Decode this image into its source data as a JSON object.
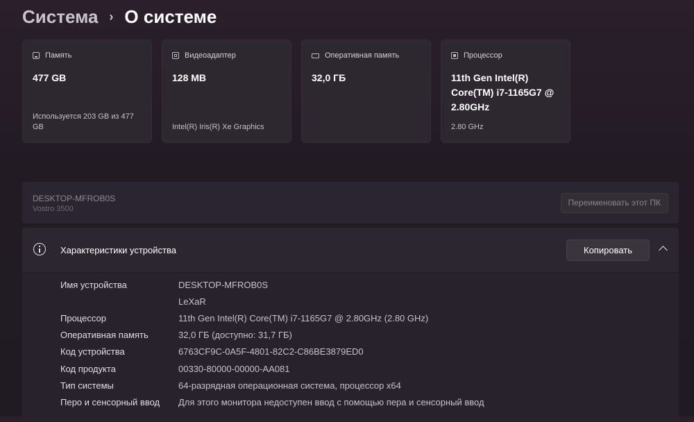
{
  "breadcrumb": {
    "parent": "Система",
    "separator": "›",
    "current": "О системе"
  },
  "cards": [
    {
      "icon": "storage-icon",
      "title": "Память",
      "value": "477 GB",
      "sub": "Используется 203 GB из 477 GB"
    },
    {
      "icon": "gpu-icon",
      "title": "Видеоадаптер",
      "value": "128 MB",
      "sub": "Intel(R) Iris(R) Xe Graphics"
    },
    {
      "icon": "ram-icon",
      "title": "Оперативная память",
      "value": "32,0 ГБ",
      "sub": ""
    },
    {
      "icon": "cpu-icon",
      "title": "Процессор",
      "value": "11th Gen Intel(R) Core(TM) i7-1165G7 @ 2.80GHz",
      "sub": "2.80 GHz"
    }
  ],
  "device": {
    "name": "DESKTOP-MFROB0S",
    "model": "Vostro 3500",
    "rename_label": "Переименовать этот ПК"
  },
  "specs": {
    "title": "Характеристики устройства",
    "copy_label": "Копировать",
    "rows": [
      {
        "label": "Имя устройства",
        "value": "DESKTOP-MFROB0S"
      },
      {
        "label": "",
        "value": "LeXaR"
      },
      {
        "label": "Процессор",
        "value": "11th Gen Intel(R) Core(TM) i7-1165G7 @ 2.80GHz (2.80 GHz)"
      },
      {
        "label": "Оперативная память",
        "value": "32,0 ГБ (доступно: 31,7 ГБ)"
      },
      {
        "label": "Код устройства",
        "value": "6763CF9C-0A5F-4801-82C2-C86BE3879ED0"
      },
      {
        "label": "Код продукта",
        "value": "00330-80000-00000-AA081"
      },
      {
        "label": "Тип системы",
        "value": "64-разрядная операционная система, процессор x64"
      },
      {
        "label": "Перо и сенсорный ввод",
        "value": "Для этого монитора недоступен ввод с помощью пера и сенсорный ввод"
      }
    ]
  }
}
